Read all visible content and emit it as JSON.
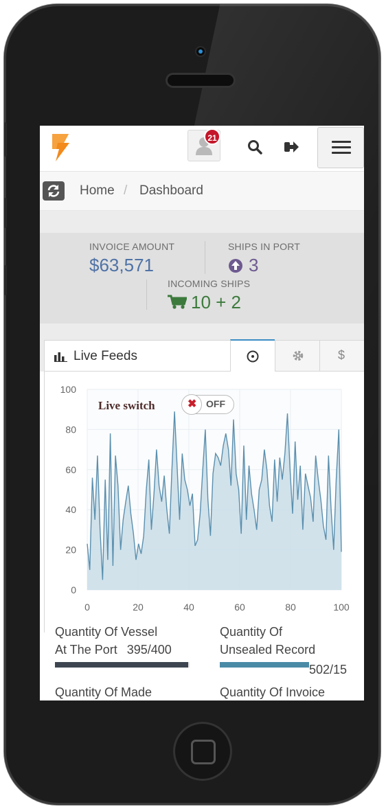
{
  "header": {
    "notification_count": "21",
    "icons": [
      "user-icon",
      "search-icon",
      "logout-icon",
      "menu-icon"
    ]
  },
  "breadcrumb": {
    "home": "Home",
    "separator": "/",
    "current": "Dashboard"
  },
  "stats": {
    "invoice_amount": {
      "label": "INVOICE AMOUNT",
      "value": "$63,571"
    },
    "ships_in_port": {
      "label": "SHIPS IN PORT",
      "value": "3"
    },
    "incoming_ships": {
      "label": "INCOMING SHIPS",
      "value": "10 + 2"
    }
  },
  "panel": {
    "title": "Live Feeds",
    "tabs": [
      {
        "icon": "clock-icon",
        "active": true
      },
      {
        "icon": "gear-icon",
        "active": false
      },
      {
        "label": "$",
        "active": false
      }
    ]
  },
  "live_switch": {
    "label": "Live switch",
    "state": "OFF"
  },
  "colors": {
    "accent_blue": "#3b8cc4",
    "badge_red": "#c4162a",
    "stat_blue": "#4f72a6",
    "stat_purple": "#6d5a8f",
    "stat_green": "#3c7a3c",
    "area_fill": "#c9dde8",
    "line": "#5a8fae"
  },
  "chart_data": {
    "type": "area",
    "xlim": [
      0,
      100
    ],
    "ylim": [
      0,
      100
    ],
    "x_ticks": [
      "0",
      "20",
      "40",
      "60",
      "80",
      "100"
    ],
    "y_ticks": [
      "0",
      "20",
      "40",
      "60",
      "80",
      "100"
    ],
    "grid": true,
    "series": [
      {
        "values": [
          23,
          10,
          56,
          35,
          67,
          30,
          5,
          55,
          15,
          78,
          12,
          67,
          52,
          20,
          35,
          44,
          52,
          38,
          28,
          15,
          23,
          18,
          27,
          50,
          65,
          30,
          48,
          70,
          52,
          44,
          57,
          40,
          28,
          60,
          89,
          62,
          35,
          68,
          55,
          50,
          42,
          48,
          22,
          25,
          38,
          60,
          80,
          45,
          27,
          58,
          68,
          66,
          62,
          72,
          78,
          70,
          52,
          85,
          58,
          50,
          28,
          72,
          35,
          62,
          48,
          40,
          30,
          50,
          55,
          70,
          60,
          42,
          34,
          65,
          44,
          66,
          55,
          68,
          88,
          60,
          38,
          74,
          45,
          62,
          30,
          58,
          52,
          46,
          34,
          67,
          55,
          45,
          32,
          25,
          67,
          40,
          20,
          55,
          80,
          19
        ]
      }
    ]
  },
  "progress": [
    {
      "label_line1": "Quantity Of Vessel",
      "label_line2": "At The Port",
      "value_text": "395/400",
      "fraction": 0.9875,
      "color": "#3d4650"
    },
    {
      "label_line1": "Quantity Of",
      "label_line2": "Unsealed Record",
      "value_text": "502/15",
      "fraction": 1.0,
      "color": "#4a8aa6"
    },
    {
      "label_line1": "Quantity Of Made",
      "label_line2": "",
      "value_text": "",
      "fraction": 0,
      "color": "#3d4650"
    },
    {
      "label_line1": "Quantity Of Invoice",
      "label_line2": "",
      "value_text": "",
      "fraction": 0,
      "color": "#4a8aa6"
    }
  ]
}
